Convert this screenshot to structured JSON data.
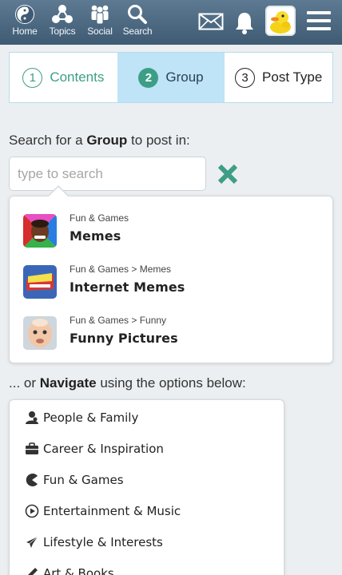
{
  "nav": {
    "items": [
      {
        "label": "Home",
        "icon": "yin-yang-icon"
      },
      {
        "label": "Topics",
        "icon": "topics-network-icon"
      },
      {
        "label": "Social",
        "icon": "people-group-icon"
      },
      {
        "label": "Search",
        "icon": "search-icon"
      }
    ],
    "right_icons": [
      "mail-icon",
      "bell-icon",
      "avatar-duck",
      "hamburger-menu-icon"
    ]
  },
  "stepper": {
    "steps": [
      {
        "num": "1",
        "label": "Contents"
      },
      {
        "num": "2",
        "label": "Group"
      },
      {
        "num": "3",
        "label": "Post Type"
      }
    ],
    "active_index": 1
  },
  "search_section": {
    "prefix": "Search for a ",
    "bold": "Group",
    "suffix": " to post in:",
    "placeholder": "type to search"
  },
  "results": [
    {
      "path": "Fun & Games",
      "name": "Memes"
    },
    {
      "path": "Fun & Games > Memes",
      "name": "Internet Memes"
    },
    {
      "path": "Fun & Games > Funny",
      "name": "Funny Pictures"
    }
  ],
  "navigate_section": {
    "prefix": "... or ",
    "bold": "Navigate",
    "suffix": " using the options below:"
  },
  "categories": [
    {
      "label": "People & Family",
      "icon": "person-icon"
    },
    {
      "label": "Career & Inspiration",
      "icon": "briefcase-icon"
    },
    {
      "label": "Fun & Games",
      "icon": "pacman-icon"
    },
    {
      "label": "Entertainment & Music",
      "icon": "play-circle-icon"
    },
    {
      "label": "Lifestyle & Interests",
      "icon": "airplane-icon"
    },
    {
      "label": "Art & Books",
      "icon": "pencil-icon"
    }
  ],
  "colors": {
    "topbar": "#4a6780",
    "accent_green": "#3d9e86",
    "active_step_bg": "#bfe3f7"
  }
}
